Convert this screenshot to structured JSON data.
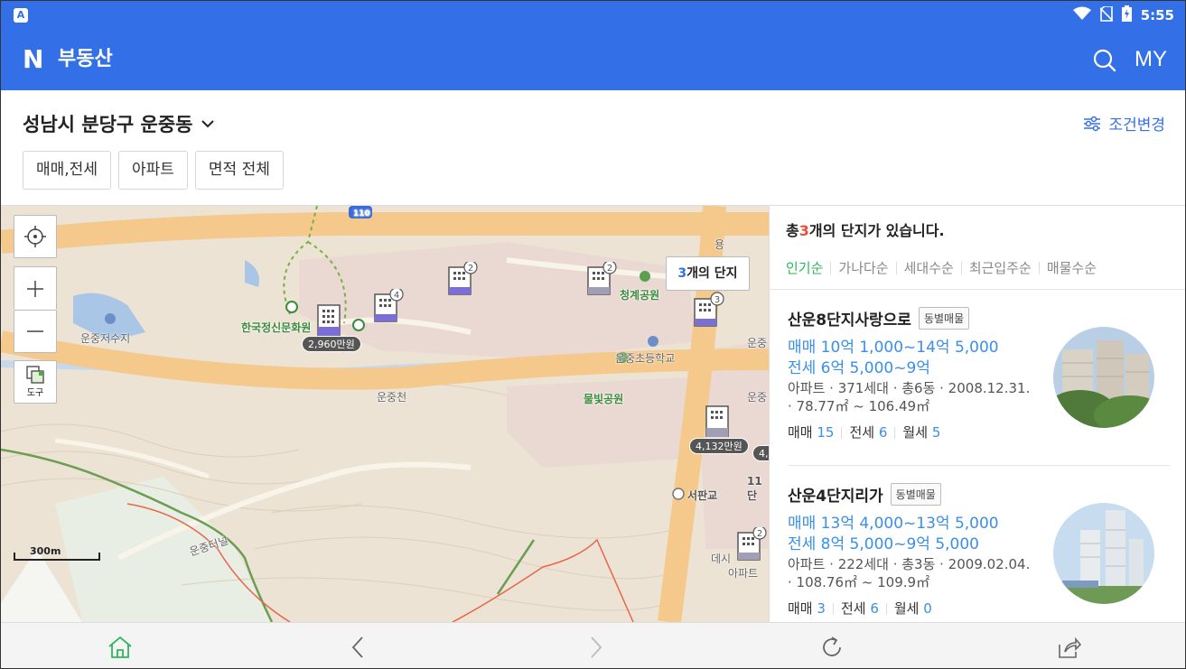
{
  "status_bar": {
    "time": "5:55",
    "left_icon": "A",
    "icons": [
      "wifi-icon",
      "no-sim-icon",
      "battery-charging-icon"
    ]
  },
  "app_bar": {
    "logo": "N",
    "title": "부동산",
    "my_label": "MY",
    "brand_color": "#3370e8"
  },
  "filter": {
    "location": "성남시 분당구 운중동",
    "condition_label": "조건변경",
    "chips": [
      "매매,전세",
      "아파트",
      "면적 전체"
    ]
  },
  "map": {
    "tool_label": "도구",
    "tooltip_count": "3",
    "tooltip_suffix": "개의 단지",
    "scale_label": "300m",
    "labels": [
      "한국정신문화원",
      "운중저수지",
      "운중천",
      "청계공원",
      "운중초등학교",
      "물빛공원",
      "서판교",
      "운중터널",
      "운중",
      "운중",
      "11단",
      "데시",
      "아파트",
      "용"
    ],
    "price_tags": [
      "2,960만원",
      "4,132만원",
      "4,"
    ],
    "marker_counts": [
      "4",
      "2",
      "2",
      "3",
      "2"
    ]
  },
  "panel": {
    "title_prefix": "총",
    "title_count": "3",
    "title_suffix": "개의 단지가 있습니다.",
    "sort_tabs": [
      "인기순",
      "가나다순",
      "세대수순",
      "최근입주순",
      "매물수순"
    ],
    "badge_label": "동별매물",
    "items": [
      {
        "name": "산운8단지사랑으로",
        "sale_price": "매매 10억 1,000~14억 5,000",
        "jeonse_price": "전세 6억 5,000~9억",
        "meta1": "아파트 · 371세대 · 총6동 · 2008.12.31.",
        "meta2": "· 78.77㎡ ~ 106.49㎡",
        "sale_label": "매매",
        "sale_count": "15",
        "jeonse_label": "전세",
        "jeonse_count": "6",
        "monthly_label": "월세",
        "monthly_count": "5"
      },
      {
        "name": "산운4단지리가",
        "sale_price": "매매 13억 4,000~13억 5,000",
        "jeonse_price": "전세 8억 5,000~9억 5,000",
        "meta1": "아파트 · 222세대 · 총3동 · 2009.02.04.",
        "meta2": "· 108.76㎡ ~ 109.9㎡",
        "sale_label": "매매",
        "sale_count": "3",
        "jeonse_label": "전세",
        "jeonse_count": "6",
        "monthly_label": "월세",
        "monthly_count": "0"
      }
    ]
  },
  "bottom_nav": [
    "home-icon",
    "back-icon",
    "forward-icon",
    "refresh-icon",
    "share-icon"
  ]
}
